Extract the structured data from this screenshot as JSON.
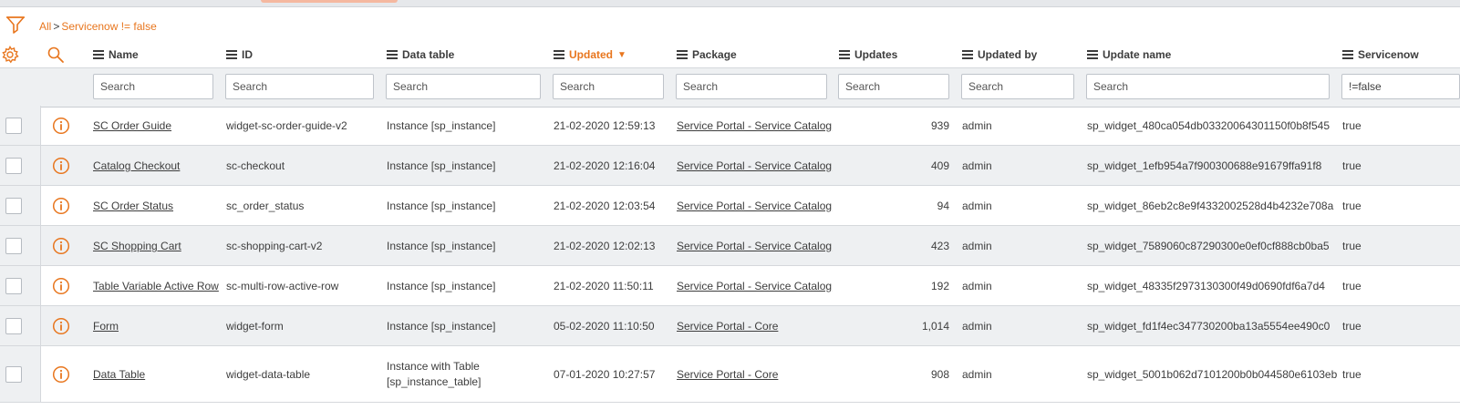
{
  "breadcrumb": {
    "root": "All",
    "separator": ">",
    "filter": "Servicenow != false"
  },
  "icons": {
    "filter": "filter-funnel-icon",
    "settings": "gear-icon",
    "search": "search-icon",
    "info": "info-icon",
    "sort": "sort-descending-icon"
  },
  "colors": {
    "accent": "#e8761e",
    "text": "#3d3d3d",
    "row_alt": "#eef0f2"
  },
  "columns": [
    {
      "label": "Name"
    },
    {
      "label": "ID"
    },
    {
      "label": "Data table"
    },
    {
      "label": "Updated",
      "sorted": "desc"
    },
    {
      "label": "Package"
    },
    {
      "label": "Updates"
    },
    {
      "label": "Updated by"
    },
    {
      "label": "Update name"
    },
    {
      "label": "Servicenow"
    }
  ],
  "search": {
    "placeholder": "Search",
    "servicenow_value": "!=false"
  },
  "rows": [
    {
      "name": "SC Order Guide",
      "id": "widget-sc-order-guide-v2",
      "data_table": "Instance [sp_instance]",
      "updated": "21-02-2020 12:59:13",
      "package": "Service Portal - Service Catalog",
      "updates": "939",
      "updated_by": "admin",
      "update_name": "sp_widget_480ca054db03320064301150f0b8f545",
      "servicenow": "true"
    },
    {
      "name": "Catalog Checkout",
      "id": "sc-checkout",
      "data_table": "Instance [sp_instance]",
      "updated": "21-02-2020 12:16:04",
      "package": "Service Portal - Service Catalog",
      "updates": "409",
      "updated_by": "admin",
      "update_name": "sp_widget_1efb954a7f900300688e91679ffa91f8",
      "servicenow": "true"
    },
    {
      "name": "SC Order Status",
      "id": "sc_order_status",
      "data_table": "Instance [sp_instance]",
      "updated": "21-02-2020 12:03:54",
      "package": "Service Portal - Service Catalog",
      "updates": "94",
      "updated_by": "admin",
      "update_name": "sp_widget_86eb2c8e9f4332002528d4b4232e708a",
      "servicenow": "true"
    },
    {
      "name": "SC Shopping Cart",
      "id": "sc-shopping-cart-v2",
      "data_table": "Instance [sp_instance]",
      "updated": "21-02-2020 12:02:13",
      "package": "Service Portal - Service Catalog",
      "updates": "423",
      "updated_by": "admin",
      "update_name": "sp_widget_7589060c87290300e0ef0cf888cb0ba5",
      "servicenow": "true"
    },
    {
      "name": "Table Variable Active Row",
      "id": "sc-multi-row-active-row",
      "data_table": "Instance [sp_instance]",
      "updated": "21-02-2020 11:50:11",
      "package": "Service Portal - Service Catalog",
      "updates": "192",
      "updated_by": "admin",
      "update_name": "sp_widget_48335f2973130300f49d0690fdf6a7d4",
      "servicenow": "true"
    },
    {
      "name": "Form",
      "id": "widget-form",
      "data_table": "Instance [sp_instance]",
      "updated": "05-02-2020 11:10:50",
      "package": "Service Portal - Core",
      "updates": "1,014",
      "updated_by": "admin",
      "update_name": "sp_widget_fd1f4ec347730200ba13a5554ee490c0",
      "servicenow": "true"
    },
    {
      "name": "Data Table",
      "id": "widget-data-table",
      "data_table": "Instance with Table [sp_instance_table]",
      "updated": "07-01-2020 10:27:57",
      "package": "Service Portal - Core",
      "updates": "908",
      "updated_by": "admin",
      "update_name": "sp_widget_5001b062d7101200b0b044580e6103eb",
      "servicenow": "true"
    }
  ]
}
